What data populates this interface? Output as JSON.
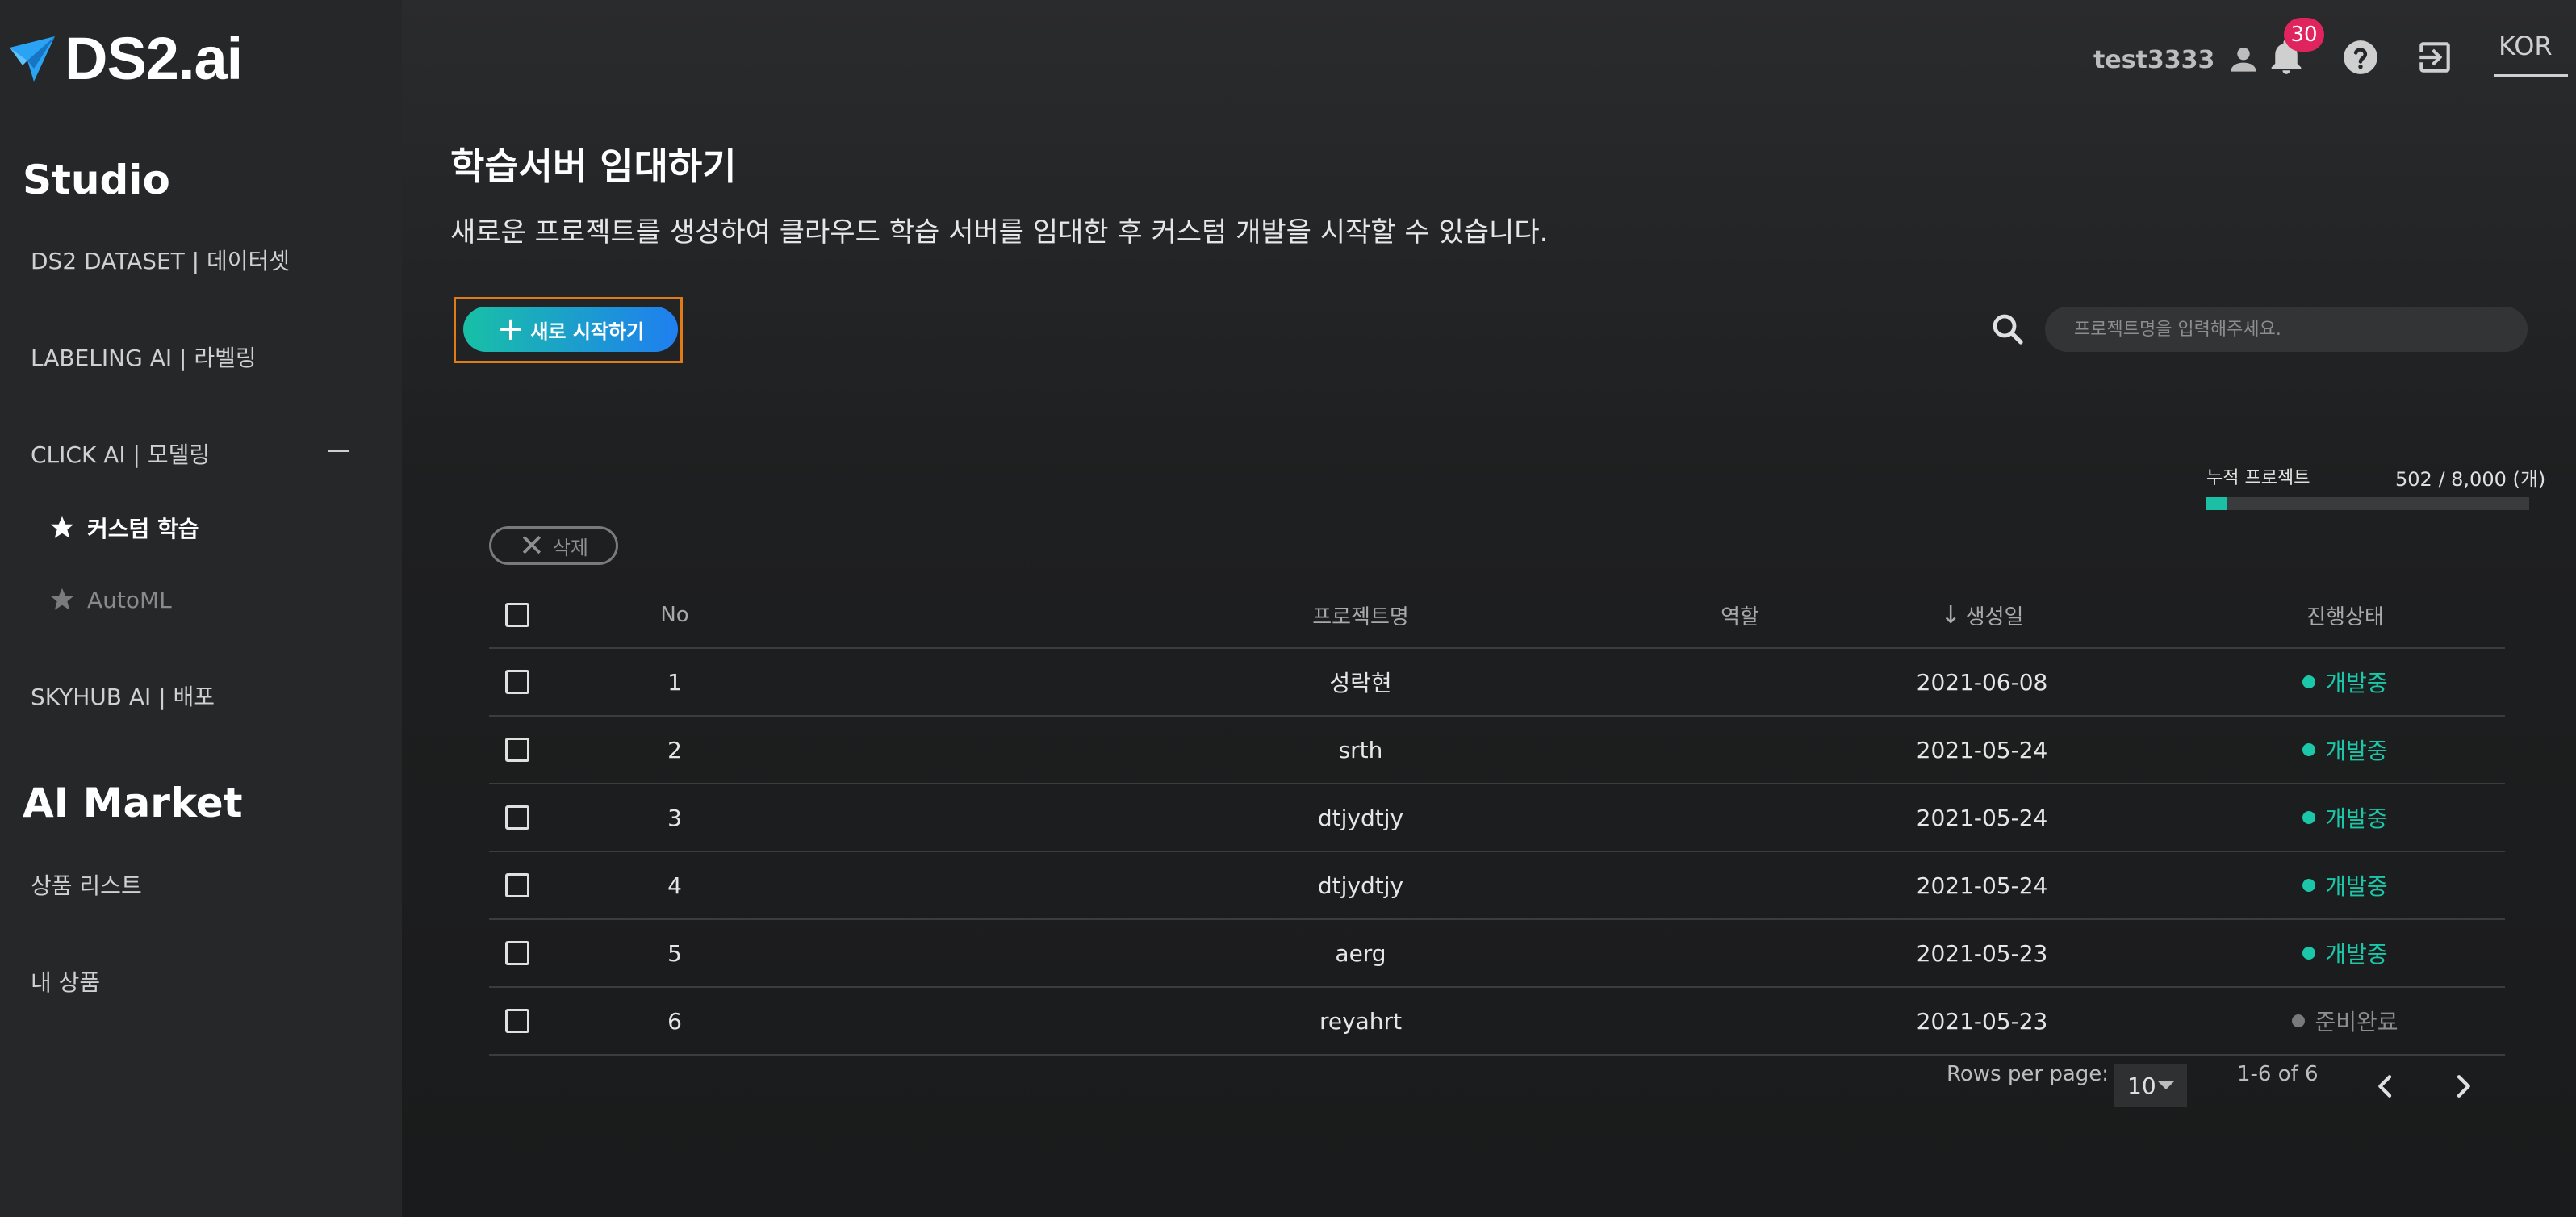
{
  "brand": {
    "name": "DS2.ai",
    "accent": "#2aa3f5"
  },
  "sidebar": {
    "studio_title": "Studio",
    "items": [
      {
        "label": "DS2 DATASET | 데이터셋"
      },
      {
        "label": "LABELING AI | 라벨링"
      },
      {
        "label": "CLICK AI | 모델링"
      },
      {
        "label": "SKYHUB AI | 배포"
      }
    ],
    "sub_items": [
      {
        "label": "커스텀 학습",
        "icon": "star-icon"
      },
      {
        "label": "AutoML",
        "icon": "star-icon"
      }
    ],
    "market_title": "AI Market",
    "market_items": [
      {
        "label": "상품 리스트"
      },
      {
        "label": "내 상품"
      }
    ]
  },
  "header": {
    "username": "test3333",
    "notification_count": "30",
    "language": "KOR",
    "icons": [
      "person-icon",
      "bell-icon",
      "help-icon",
      "logout-icon"
    ]
  },
  "main": {
    "title": "학습서버 임대하기",
    "description": "새로운 프로젝트를 생성하여 클라우드 학습 서버를 임대한 후 커스텀 개발을 시작할 수 있습니다.",
    "new_button": "새로 시작하기",
    "search_placeholder": "프로젝트명을 입력해주세요.",
    "quota_label": "누적 프로젝트",
    "quota_value": "502 / 8,000 (개)",
    "quota_fraction": 0.06275,
    "delete_button": "삭제"
  },
  "table": {
    "columns": [
      "No",
      "프로젝트명",
      "역할",
      "생성일",
      "진행상태"
    ],
    "rows": [
      {
        "no": "1",
        "name": "성락현",
        "role": "",
        "date": "2021-06-08",
        "status": "개발중"
      },
      {
        "no": "2",
        "name": "srth",
        "role": "",
        "date": "2021-05-24",
        "status": "개발중"
      },
      {
        "no": "3",
        "name": "dtjydtjy",
        "role": "",
        "date": "2021-05-24",
        "status": "개발중"
      },
      {
        "no": "4",
        "name": "dtjydtjy",
        "role": "",
        "date": "2021-05-24",
        "status": "개발중"
      },
      {
        "no": "5",
        "name": "aerg",
        "role": "",
        "date": "2021-05-23",
        "status": "개발중"
      },
      {
        "no": "6",
        "name": "reyahrt",
        "role": "",
        "date": "2021-05-23",
        "status": "준비완료"
      }
    ],
    "status_colors": {
      "dev": "#1bc7a8",
      "ready": "#7a7a7a"
    }
  },
  "pagination": {
    "rows_per_page_label": "Rows per page:",
    "rows_per_page_value": "10",
    "range": "1-6 of 6"
  }
}
